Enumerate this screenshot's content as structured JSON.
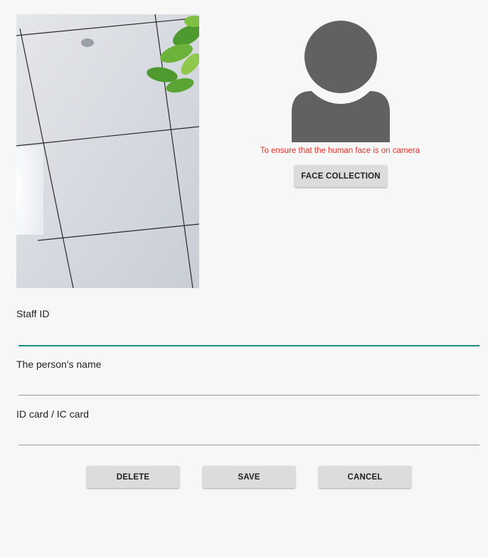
{
  "camera": {
    "icon": "camera-preview"
  },
  "avatar": {
    "icon": "person-silhouette-icon",
    "color": "#616161"
  },
  "hint_text": "To ensure that the human face is on camera",
  "hint_color": "#e5332a",
  "buttons": {
    "face_collection": "FACE COLLECTION",
    "delete": "DELETE",
    "save": "SAVE",
    "cancel": "CANCEL"
  },
  "form": {
    "staff_id": {
      "label": "Staff ID",
      "value": ""
    },
    "name": {
      "label": "The person's name",
      "value": ""
    },
    "card": {
      "label": "ID card / IC card",
      "value": ""
    }
  },
  "accent_color": "#1e8a84"
}
